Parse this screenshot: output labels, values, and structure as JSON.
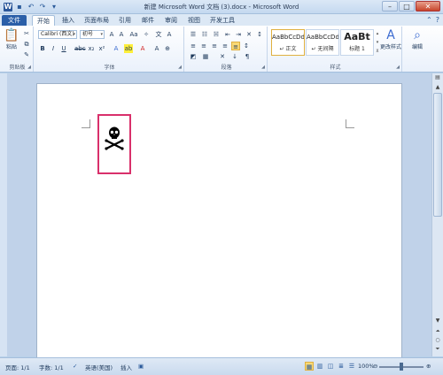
{
  "window": {
    "title": "新建 Microsoft Word 文档 (3).docx - Microsoft Word"
  },
  "tabs": [
    {
      "label": "文件"
    },
    {
      "label": "开始"
    },
    {
      "label": "插入"
    },
    {
      "label": "页面布局"
    },
    {
      "label": "引用"
    },
    {
      "label": "邮件"
    },
    {
      "label": "审阅"
    },
    {
      "label": "视图"
    },
    {
      "label": "开发工具"
    }
  ],
  "ribbon": {
    "clipboard": {
      "paste_label": "粘贴",
      "group_label": "剪贴板"
    },
    "font": {
      "font_name": "Calibri (西文)",
      "font_size": "初号",
      "group_label": "字体"
    },
    "paragraph": {
      "group_label": "段落"
    },
    "styles": {
      "group_label": "样式",
      "items": [
        {
          "preview": "AaBbCcDd",
          "name": "↵ 正文"
        },
        {
          "preview": "AaBbCcDd",
          "name": "↵ 无间隔"
        },
        {
          "preview": "AaBt",
          "name": "标题 1"
        }
      ],
      "change_styles_label": "更改样式"
    },
    "editing": {
      "label": "编辑"
    }
  },
  "document": {
    "symbol": "☠"
  },
  "status": {
    "page": "页面: 1/1",
    "words": "字数: 1/1",
    "language": "英语(美国)",
    "mode": "插入",
    "zoom": "100%"
  }
}
